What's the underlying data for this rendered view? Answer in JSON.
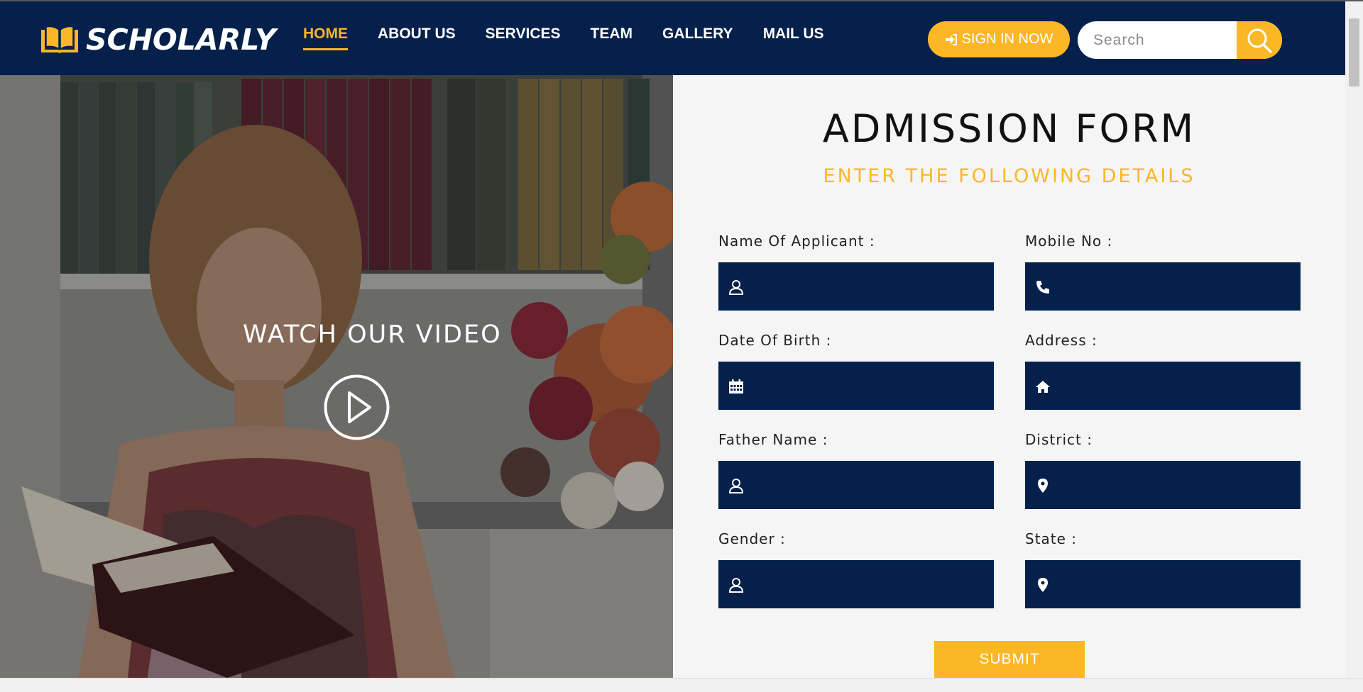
{
  "header": {
    "brand": "SCHOLARLY",
    "nav": [
      {
        "label": "HOME"
      },
      {
        "label": "ABOUT US"
      },
      {
        "label": "SERVICES"
      },
      {
        "label": "TEAM"
      },
      {
        "label": "GALLERY"
      },
      {
        "label": "MAIL US"
      }
    ],
    "active_nav": "HOME",
    "signin_label": "SIGN IN NOW",
    "search_placeholder": "Search"
  },
  "hero": {
    "title": "WATCH OUR VIDEO"
  },
  "form": {
    "title": "ADMISSION FORM",
    "subtitle": "ENTER THE FOLLOWING DETAILS",
    "fields": [
      {
        "label": "Name Of Applicant :",
        "icon": "user-icon",
        "value": ""
      },
      {
        "label": "Mobile No :",
        "icon": "phone-icon",
        "value": ""
      },
      {
        "label": "Date Of Birth :",
        "icon": "calendar-icon",
        "value": ""
      },
      {
        "label": "Address :",
        "icon": "home-icon",
        "value": ""
      },
      {
        "label": "Father Name :",
        "icon": "user-icon",
        "value": ""
      },
      {
        "label": "District :",
        "icon": "map-marker-icon",
        "value": ""
      },
      {
        "label": "Gender :",
        "icon": "user-icon",
        "value": ""
      },
      {
        "label": "State :",
        "icon": "map-marker-icon",
        "value": ""
      }
    ],
    "submit_label": "SUBMIT"
  },
  "colors": {
    "navy": "#04204b",
    "accent": "#fbb725",
    "panel_bg": "#f5f5f5"
  }
}
